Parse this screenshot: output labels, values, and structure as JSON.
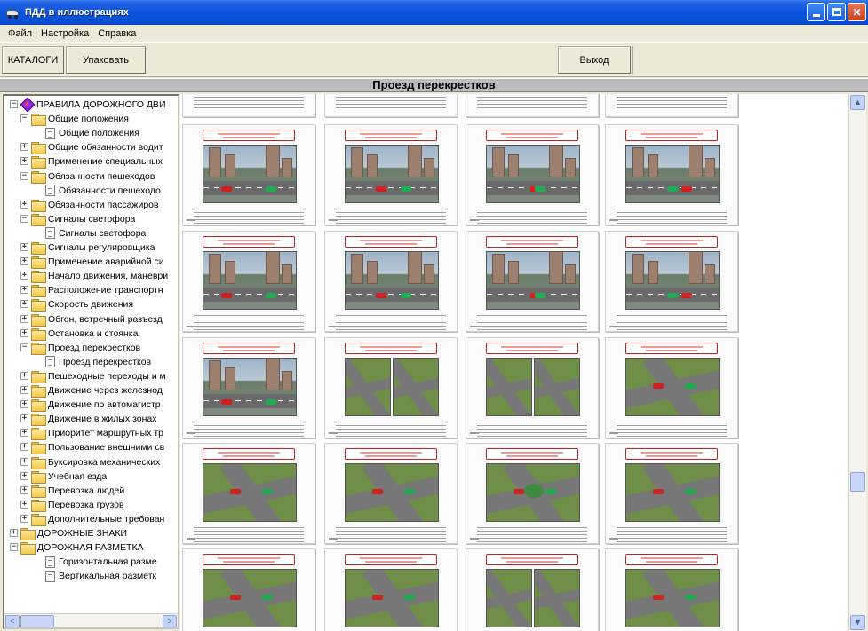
{
  "window": {
    "title": "ПДД в иллюстрациях"
  },
  "menu": {
    "items": [
      "Файл",
      "Настройка",
      "Справка"
    ]
  },
  "toolbar": {
    "catalogs_label": "КАТАЛОГИ",
    "pack_label": "Упаковать",
    "exit_label": "Выход"
  },
  "header": {
    "title": "Проезд перекрестков"
  },
  "tree": {
    "items": [
      {
        "label": "ПРАВИЛА ДОРОЖНОГО ДВИ",
        "level": 0,
        "icon": "book-icon",
        "expander": "-"
      },
      {
        "label": "Общие положения",
        "level": 1,
        "icon": "folder-icon",
        "expander": "-"
      },
      {
        "label": "Общие положения",
        "level": 2,
        "icon": "document-icon",
        "expander": ""
      },
      {
        "label": "Общие обязанности водит",
        "level": 1,
        "icon": "folder-icon",
        "expander": "+"
      },
      {
        "label": "Применение специальных",
        "level": 1,
        "icon": "folder-icon",
        "expander": "+"
      },
      {
        "label": "Обязанности пешеходов",
        "level": 1,
        "icon": "folder-icon",
        "expander": "-"
      },
      {
        "label": "Обязанности пешеходо",
        "level": 2,
        "icon": "document-icon",
        "expander": ""
      },
      {
        "label": "Обязанности пассажиров",
        "level": 1,
        "icon": "folder-icon",
        "expander": "+"
      },
      {
        "label": "Сигналы светофора",
        "level": 1,
        "icon": "folder-icon",
        "expander": "-"
      },
      {
        "label": "Сигналы светофора",
        "level": 2,
        "icon": "document-icon",
        "expander": ""
      },
      {
        "label": "Сигналы регулировщика",
        "level": 1,
        "icon": "folder-icon",
        "expander": "+"
      },
      {
        "label": "Применение аварийной си",
        "level": 1,
        "icon": "folder-icon",
        "expander": "+"
      },
      {
        "label": "Начало движения, маневри",
        "level": 1,
        "icon": "folder-icon",
        "expander": "+"
      },
      {
        "label": "Расположение транспортн",
        "level": 1,
        "icon": "folder-icon",
        "expander": "+"
      },
      {
        "label": "Скорость движения",
        "level": 1,
        "icon": "folder-icon",
        "expander": "+"
      },
      {
        "label": "Обгон, встречный разъезд",
        "level": 1,
        "icon": "folder-icon",
        "expander": "+"
      },
      {
        "label": "Остановка и стоянка",
        "level": 1,
        "icon": "folder-icon",
        "expander": "+"
      },
      {
        "label": "Проезд перекрестков",
        "level": 1,
        "icon": "folder-icon",
        "expander": "-"
      },
      {
        "label": "Проезд перекрестков",
        "level": 2,
        "icon": "document-icon",
        "expander": ""
      },
      {
        "label": "Пешеходные переходы и м",
        "level": 1,
        "icon": "folder-icon",
        "expander": "+"
      },
      {
        "label": "Движение через железнод",
        "level": 1,
        "icon": "folder-icon",
        "expander": "+"
      },
      {
        "label": "Движение по автомагистр",
        "level": 1,
        "icon": "folder-icon",
        "expander": "+"
      },
      {
        "label": "Движение в жилых зонах",
        "level": 1,
        "icon": "folder-icon",
        "expander": "+"
      },
      {
        "label": "Приоритет маршрутных тр",
        "level": 1,
        "icon": "folder-icon",
        "expander": "+"
      },
      {
        "label": "Пользование внешними св",
        "level": 1,
        "icon": "folder-icon",
        "expander": "+"
      },
      {
        "label": "Буксировка механических",
        "level": 1,
        "icon": "folder-icon",
        "expander": "+"
      },
      {
        "label": "Учебная езда",
        "level": 1,
        "icon": "folder-icon",
        "expander": "+"
      },
      {
        "label": "Перевозка людей",
        "level": 1,
        "icon": "folder-icon",
        "expander": "+"
      },
      {
        "label": "Перевозка грузов",
        "level": 1,
        "icon": "folder-icon",
        "expander": "+"
      },
      {
        "label": "Дополнительные требован",
        "level": 1,
        "icon": "folder-icon",
        "expander": "+"
      },
      {
        "label": "ДОРОЖНЫЕ ЗНАКИ",
        "level": 0,
        "icon": "folder-icon",
        "expander": "+"
      },
      {
        "label": "ДОРОЖНАЯ РАЗМЕТКА",
        "level": 0,
        "icon": "folder-icon",
        "expander": "-"
      },
      {
        "label": "Горизонтальная разме",
        "level": 2,
        "icon": "document-icon",
        "expander": ""
      },
      {
        "label": "Вертикальная разметк",
        "level": 2,
        "icon": "document-icon",
        "expander": ""
      }
    ]
  },
  "slides": {
    "rows": [
      [
        "partial",
        "partial",
        "partial",
        "partial"
      ],
      [
        "street",
        "street",
        "street",
        "street"
      ],
      [
        "street",
        "street",
        "street",
        "street"
      ],
      [
        "street",
        "double",
        "double",
        "cross"
      ],
      [
        "cross",
        "cross",
        "round",
        "cross"
      ],
      [
        "cross",
        "cross",
        "double",
        "cross"
      ]
    ]
  },
  "icons": {
    "app": "car-icon",
    "minimize": "minimize-icon",
    "maximize": "maximize-icon",
    "close": "close-icon"
  }
}
